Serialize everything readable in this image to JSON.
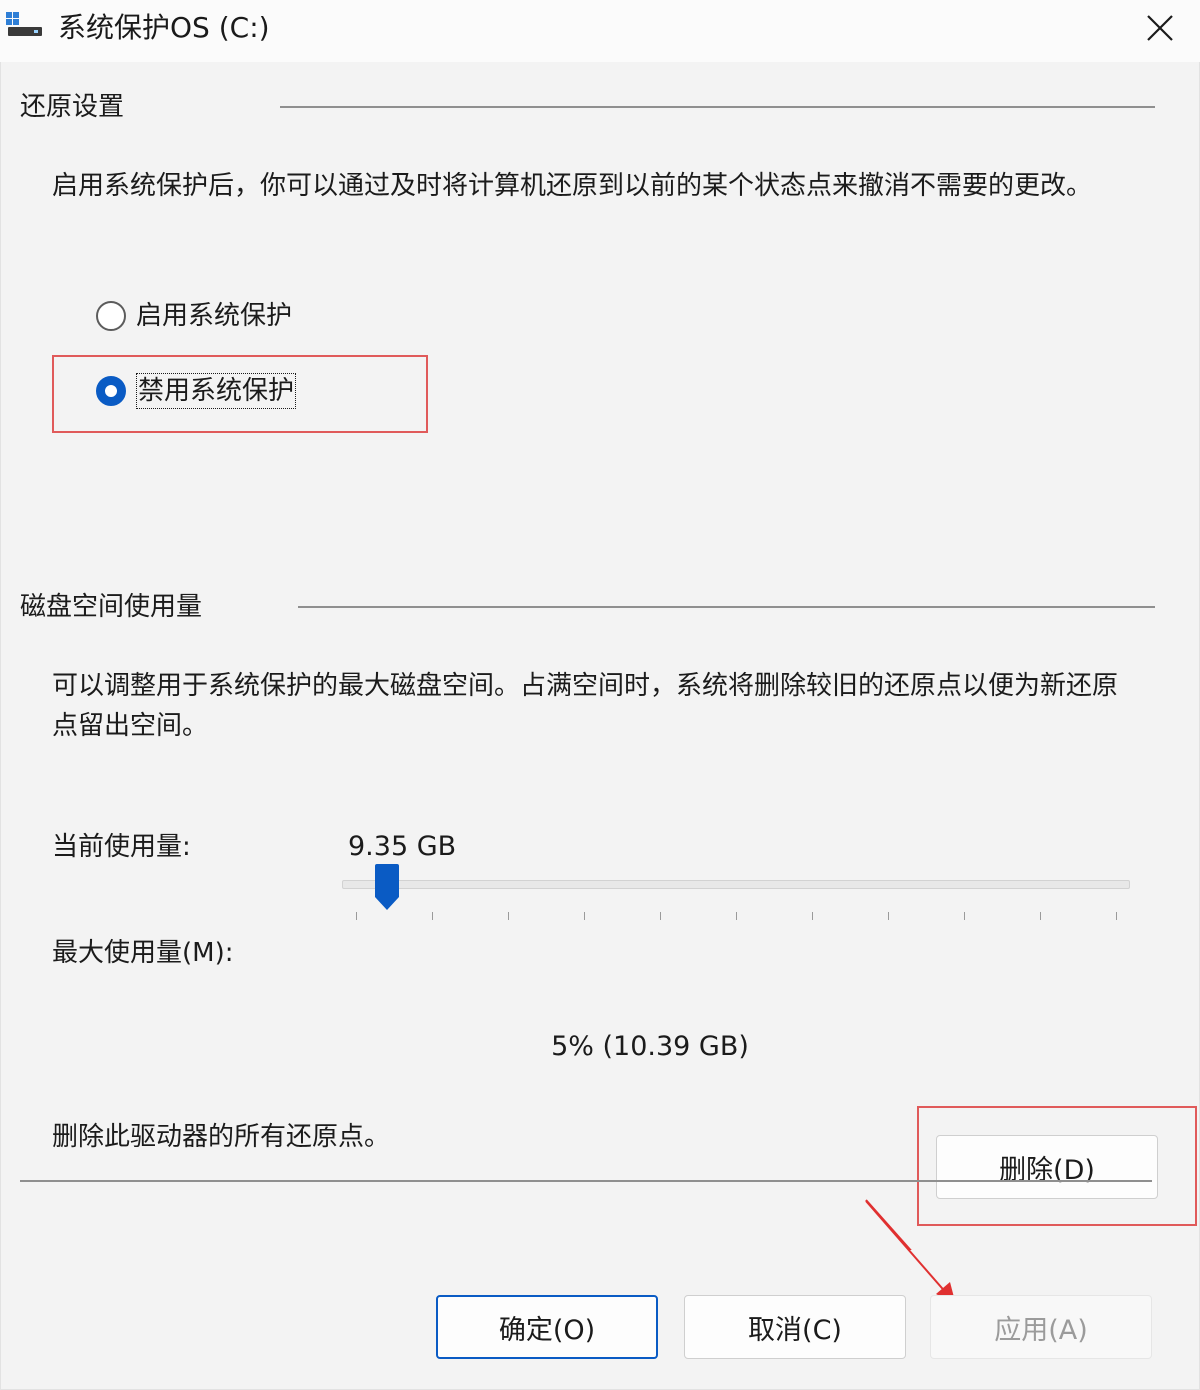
{
  "window": {
    "title": "系统保护OS (C:)"
  },
  "restore": {
    "group_title": "还原设置",
    "description": "启用系统保护后，你可以通过及时将计算机还原到以前的某个状态点来撤消不需要的更改。",
    "options": [
      {
        "label": "启用系统保护",
        "checked": false
      },
      {
        "label": "禁用系统保护",
        "checked": true
      }
    ]
  },
  "disk": {
    "group_title": "磁盘空间使用量",
    "description": "可以调整用于系统保护的最大磁盘空间。占满空间时，系统将删除较旧的还原点以便为新还原点留出空间。",
    "current_label": "当前使用量:",
    "current_value": "9.35 GB",
    "max_label": "最大使用量(M):",
    "max_percent": 5,
    "max_readout": "5% (10.39 GB)",
    "delete_text": "删除此驱动器的所有还原点。",
    "delete_button": "删除(D)"
  },
  "footer": {
    "ok_button": "确定(O)",
    "cancel_button": "取消(C)",
    "apply_button": "应用(A)",
    "apply_enabled": false
  },
  "colors": {
    "accent": "#0a5bc4",
    "annotation_red": "#e05a5a",
    "dialog_background": "#f3f3f3"
  },
  "icons": [
    "drive-icon",
    "close-icon",
    "slider-thumb",
    "annotation-arrow"
  ]
}
